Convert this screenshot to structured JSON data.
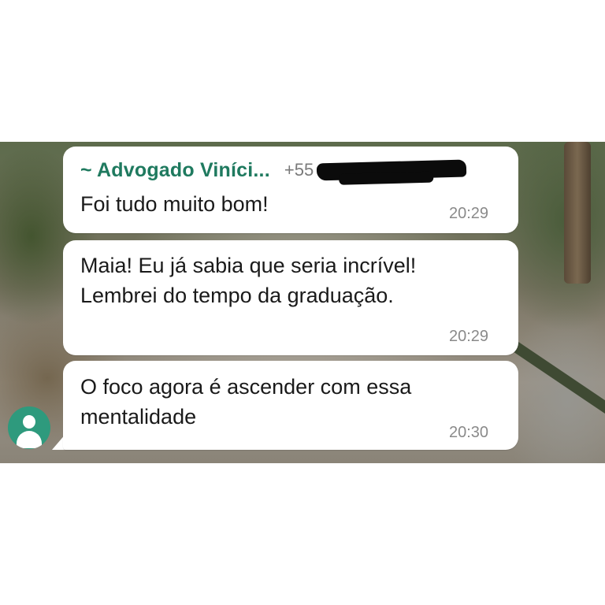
{
  "chat": {
    "colors": {
      "sender_name": "#1f7a5f",
      "avatar_bg": "#2e9a7d",
      "bubble": "#ffffff",
      "timestamp": "#8a8a8a"
    },
    "sender": {
      "name": "~ Advogado Viníci...",
      "phone_prefix": "+55",
      "phone_redacted": true
    },
    "avatar": {
      "icon": "default-person-avatar-icon"
    },
    "messages": [
      {
        "lines": [
          "Foi tudo muito bom!"
        ],
        "time": "20:29"
      },
      {
        "lines": [
          "Maia! Eu já sabia que seria incrível!",
          "Lembrei do tempo da graduação."
        ],
        "time": "20:29"
      },
      {
        "lines": [
          "O foco agora é ascender com essa",
          "mentalidade"
        ],
        "time": "20:30"
      }
    ]
  }
}
